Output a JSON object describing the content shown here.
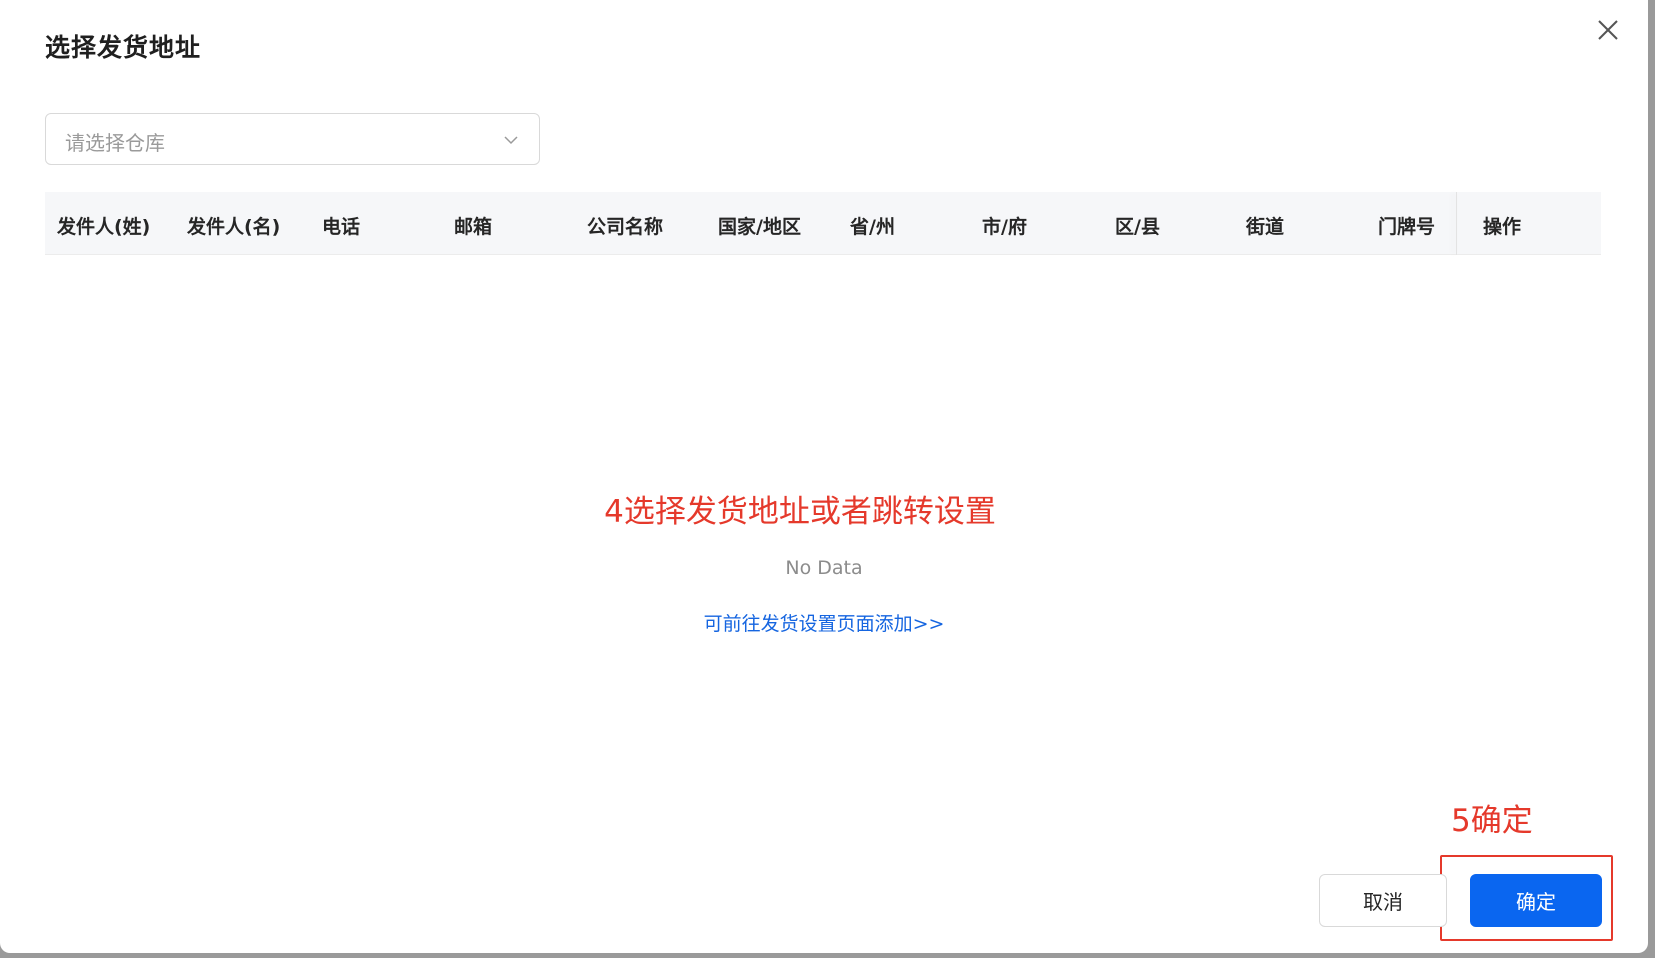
{
  "modal": {
    "title": "选择发货地址"
  },
  "warehouse_select": {
    "placeholder": "请选择仓库"
  },
  "table": {
    "columns": [
      "发件人(姓)",
      "发件人(名)",
      "电话",
      "邮箱",
      "公司名称",
      "国家/地区",
      "省/州",
      "市/府",
      "区/县",
      "街道",
      "门牌号",
      "操作"
    ],
    "empty_text": "No Data",
    "add_link": "可前往发货设置页面添加>>"
  },
  "annotations": {
    "step4": "4选择发货地址或者跳转设置",
    "step5": "5确定",
    "color": "#e5392b"
  },
  "footer": {
    "cancel_label": "取消",
    "ok_label": "确定"
  },
  "colors": {
    "primary": "#0a66f0",
    "link": "#1565e0",
    "header_bg": "#f6f7f9"
  },
  "icons": {
    "close": "close-icon",
    "select_arrow": "chevron-down-icon"
  }
}
